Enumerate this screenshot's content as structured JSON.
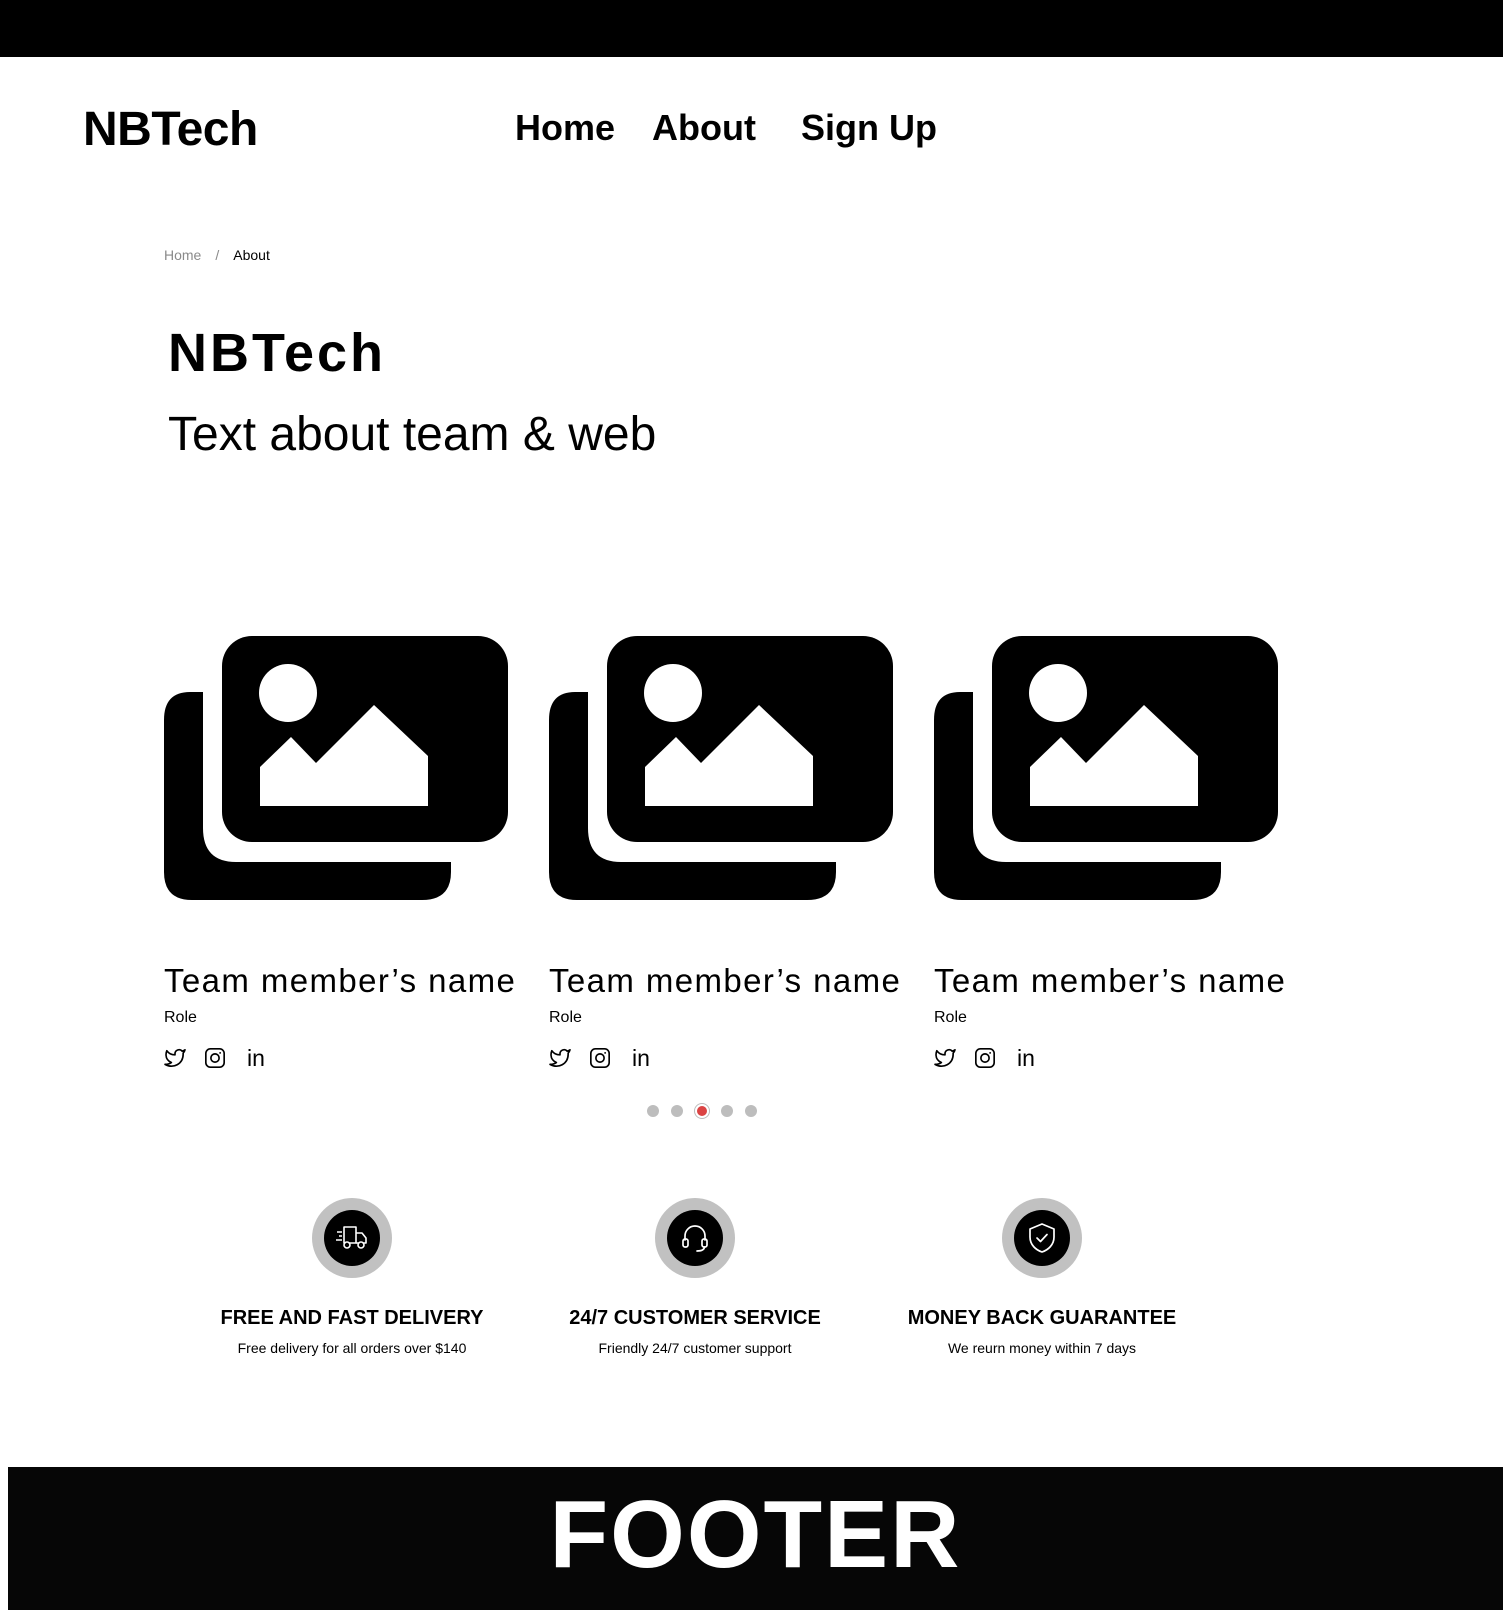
{
  "header": {
    "logo": "NBTech",
    "nav": [
      {
        "label": "Home"
      },
      {
        "label": "About"
      },
      {
        "label": "Sign Up"
      }
    ]
  },
  "breadcrumb": {
    "home": "Home",
    "separator": "/",
    "current": "About"
  },
  "hero": {
    "title": "NBTech",
    "subtitle": "Text about team & web"
  },
  "team": [
    {
      "name": "Team member’s name",
      "role": "Role",
      "photo_icon": "image-gallery-icon",
      "socials": [
        "twitter-icon",
        "instagram-icon",
        "linkedin-icon"
      ],
      "linkedin_label": "in"
    },
    {
      "name": "Team member’s name",
      "role": "Role",
      "photo_icon": "image-gallery-icon",
      "socials": [
        "twitter-icon",
        "instagram-icon",
        "linkedin-icon"
      ],
      "linkedin_label": "in"
    },
    {
      "name": "Team member’s name",
      "role": "Role",
      "photo_icon": "image-gallery-icon",
      "socials": [
        "twitter-icon",
        "instagram-icon",
        "linkedin-icon"
      ],
      "linkedin_label": "in"
    }
  ],
  "carousel": {
    "dot_count": 5,
    "active_index": 2,
    "active_color": "#db4444",
    "inactive_color": "#bdbdbd"
  },
  "features": [
    {
      "icon": "delivery-truck-icon",
      "title": "FREE AND FAST DELIVERY",
      "description": "Free delivery for all orders over $140"
    },
    {
      "icon": "headset-icon",
      "title": "24/7 CUSTOMER SERVICE",
      "description": "Friendly 24/7 customer support"
    },
    {
      "icon": "shield-check-icon",
      "title": "MONEY BACK GUARANTEE",
      "description": "We reurn money within 7 days"
    }
  ],
  "footer": {
    "label": "FOOTER"
  }
}
